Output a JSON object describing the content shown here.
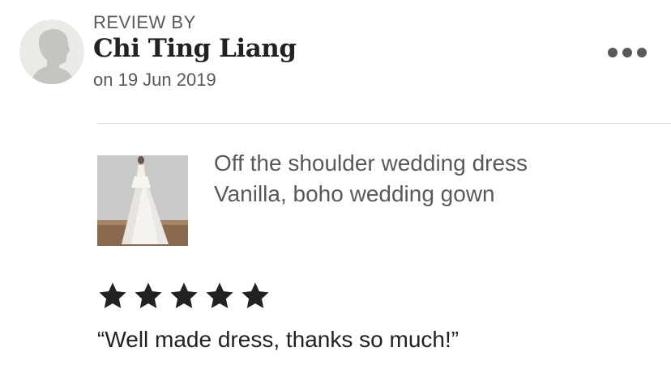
{
  "reviewer": {
    "heading": "REVIEW BY",
    "name": "Chi Ting Liang",
    "date": "on 19 Jun 2019",
    "avatar_icon": "person-silhouette-icon"
  },
  "menu": {
    "icon": "more-options-icon"
  },
  "listing": {
    "title_line1": "Off the shoulder wedding dress",
    "title_line2": "Vanilla, boho wedding gown",
    "image_icon": "product-photo-wedding-dress"
  },
  "rating": {
    "value": 5,
    "max": 5,
    "star_color": "#222222"
  },
  "review": {
    "text": "“Well made dress, thanks so much!”"
  }
}
